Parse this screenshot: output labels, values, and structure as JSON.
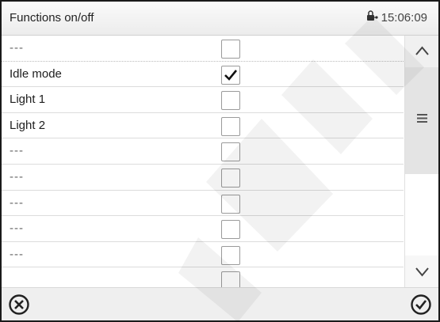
{
  "header": {
    "title": "Functions on/off",
    "time": "15:06:09",
    "lock_icon": "lock-icon"
  },
  "rows": [
    {
      "label": "---",
      "checked": false
    },
    {
      "label": "Idle mode",
      "checked": true
    },
    {
      "label": "Light 1",
      "checked": false
    },
    {
      "label": "Light 2",
      "checked": false
    },
    {
      "label": "---",
      "checked": false
    },
    {
      "label": "---",
      "checked": false
    },
    {
      "label": "---",
      "checked": false
    },
    {
      "label": "---",
      "checked": false
    },
    {
      "label": "---",
      "checked": false
    }
  ],
  "scrollbar": {
    "up_icon": "chevron-up-icon",
    "thumb_icon": "menu-icon",
    "down_icon": "chevron-down-icon"
  },
  "footer": {
    "cancel_icon": "cancel-icon",
    "confirm_icon": "confirm-icon"
  },
  "colors": {
    "border": "#1a1a1a",
    "row_divider": "#dcdcdc",
    "text": "#1e1e1e"
  }
}
